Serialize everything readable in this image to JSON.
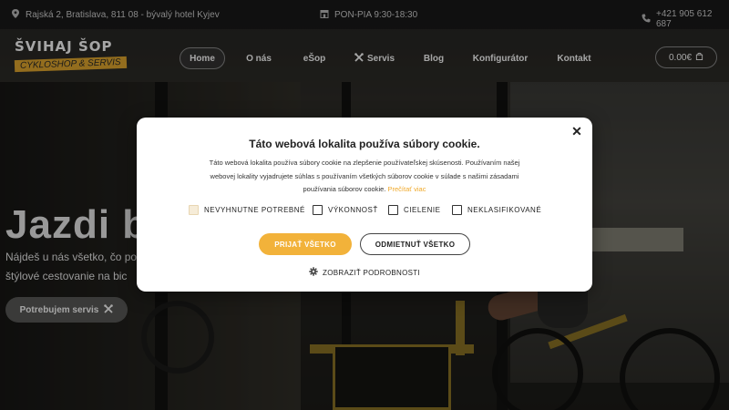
{
  "topbar": {
    "address": "Rajská 2, Bratislava, 811 08 - bývalý hotel Kyjev",
    "hours": "PON-PIA 9:30-18:30",
    "phone": "+421 905 612 687"
  },
  "header": {
    "logo_name": "ŠVIHAJ ŠOP",
    "logo_tag": "CYKLOSHOP & SERVIS",
    "nav": [
      {
        "label": "Home"
      },
      {
        "label": "O nás"
      },
      {
        "label": "eŠop"
      },
      {
        "label": "Servis"
      },
      {
        "label": "Blog"
      },
      {
        "label": "Konfigurátor"
      },
      {
        "label": "Kontakt"
      }
    ],
    "cart_total": "0.00€"
  },
  "hero": {
    "title": "Jazdi b",
    "subtitle": "Nájdeš u nás všetko, čo pot a štýlové cestovanie na bic",
    "button": "Potrebujem servis"
  },
  "cookie": {
    "title": "Táto webová lokalita používa súbory cookie.",
    "description": "Táto webová lokalita používa súbory cookie na zlepšenie používateľskej skúsenosti. Používaním našej webovej lokality vyjadrujete súhlas s používaním všetkých súborov cookie v súlade s našimi zásadami používania súborov cookie.",
    "read_more": "Prečítať viac",
    "checkboxes": [
      {
        "label": "NEVYHNUTNE POTREBNÉ",
        "checked": true,
        "disabled": true
      },
      {
        "label": "VÝKONNOSŤ",
        "checked": false
      },
      {
        "label": "CIELENIE",
        "checked": false
      },
      {
        "label": "NEKLASIFIKOVANÉ",
        "checked": false
      }
    ],
    "accept": "PRIJAŤ VŠETKO",
    "reject": "ODMIETNUŤ VŠETKO",
    "details": "ZOBRAZIŤ PODROBNOSTI"
  },
  "colors": {
    "accent": "#f2b23a",
    "brand_tag": "#e2a82e"
  }
}
